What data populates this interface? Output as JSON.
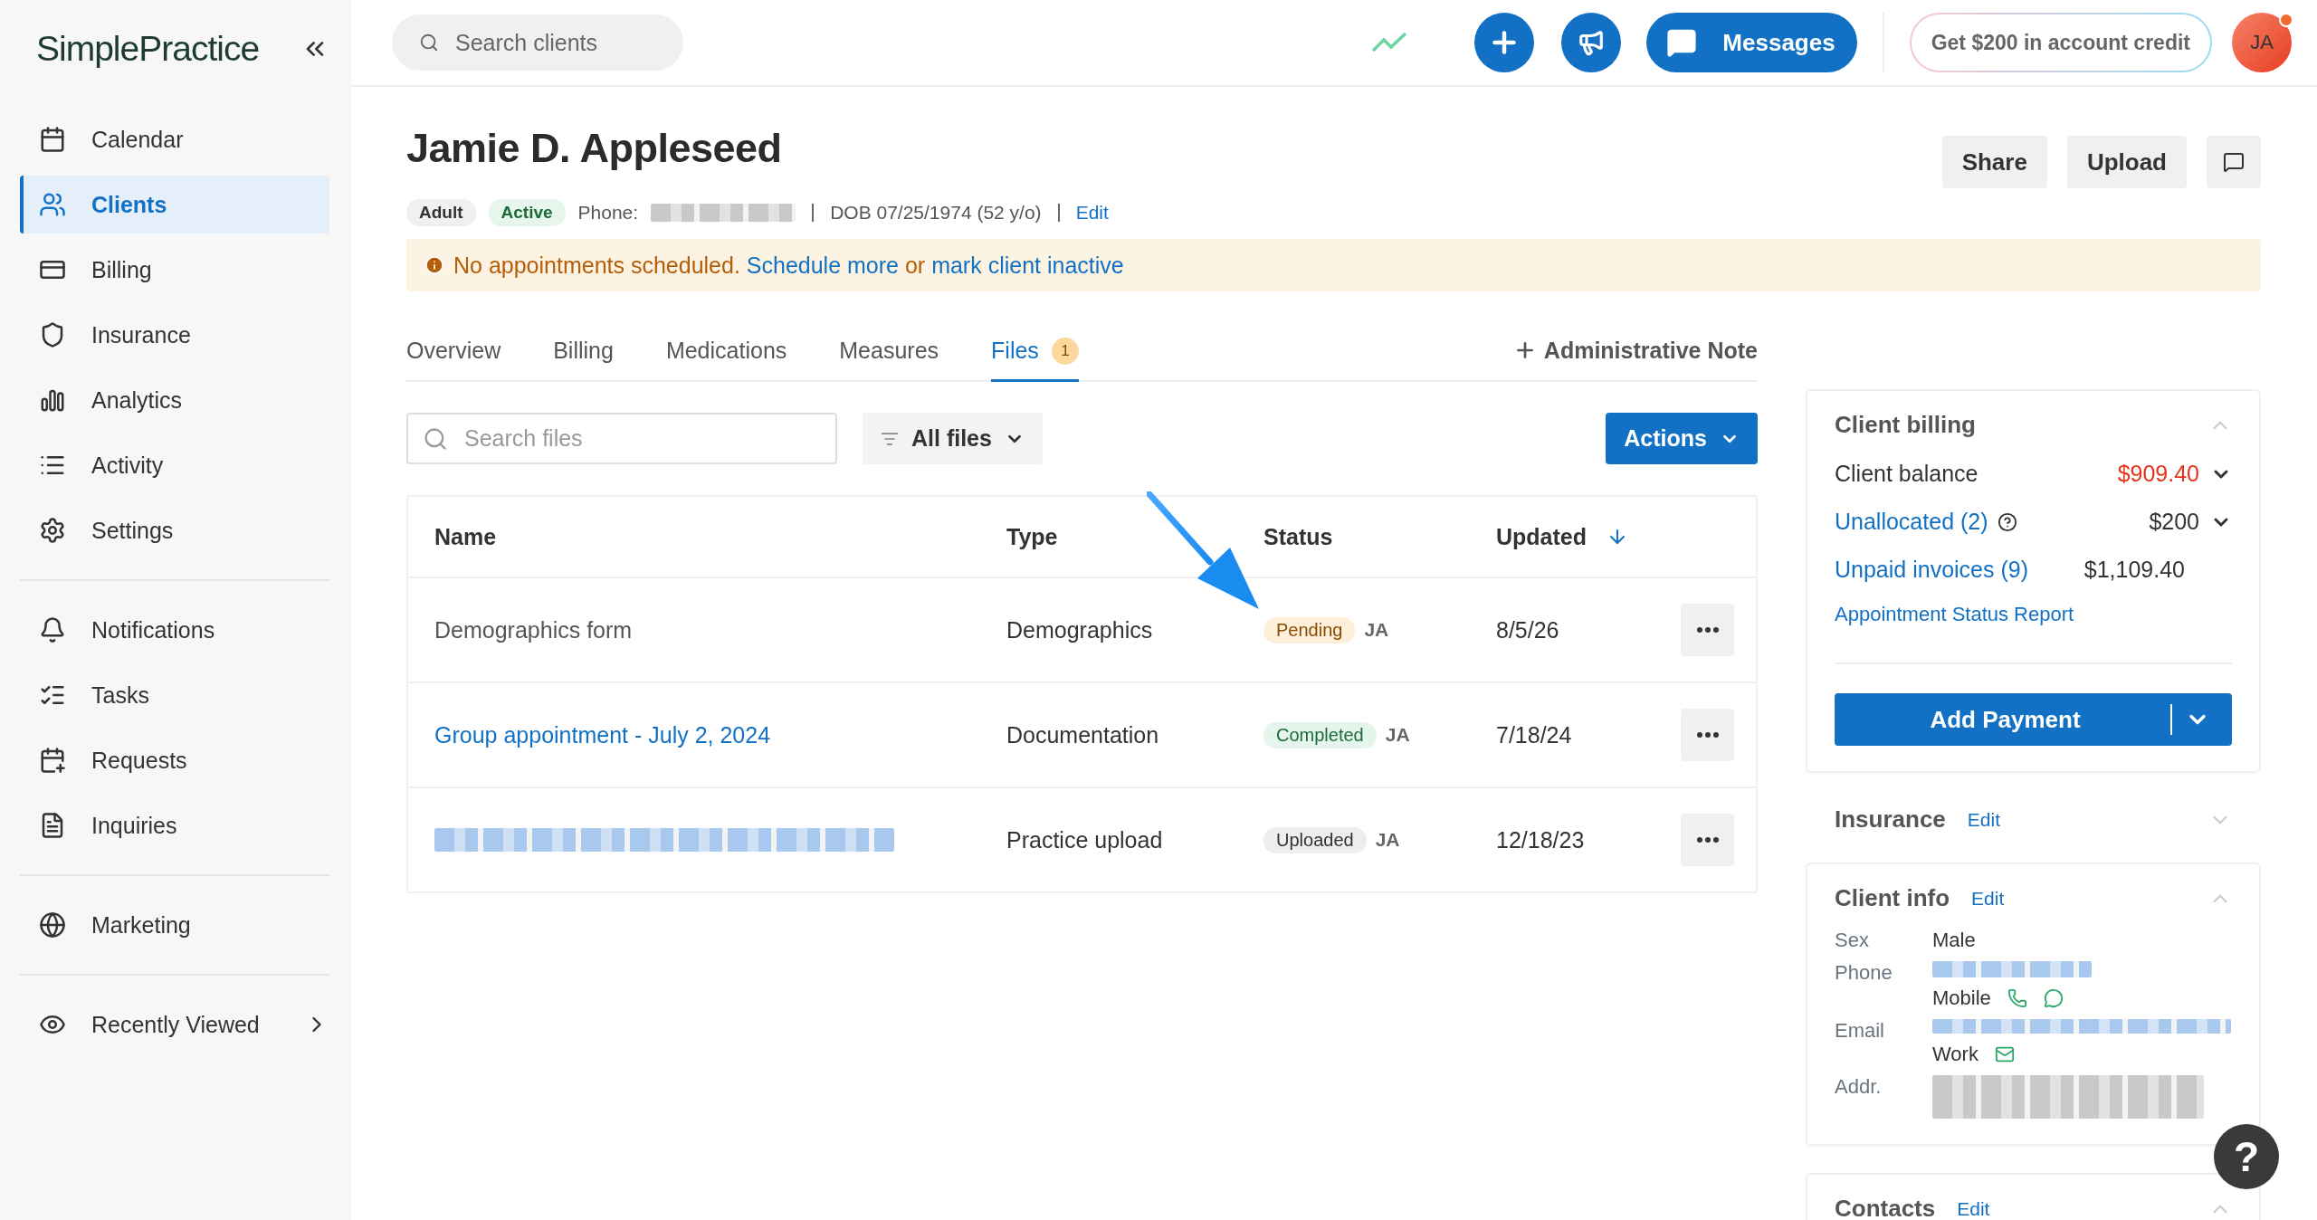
{
  "sidebar": {
    "logo": "SimplePractice",
    "sections": [
      {
        "items": [
          {
            "label": "Calendar",
            "selected": false
          },
          {
            "label": "Clients",
            "selected": true
          },
          {
            "label": "Billing",
            "selected": false
          },
          {
            "label": "Insurance",
            "selected": false
          },
          {
            "label": "Analytics",
            "selected": false
          },
          {
            "label": "Activity",
            "selected": false
          },
          {
            "label": "Settings",
            "selected": false
          }
        ]
      },
      {
        "items": [
          {
            "label": "Notifications",
            "selected": false
          },
          {
            "label": "Tasks",
            "selected": false
          },
          {
            "label": "Requests",
            "selected": false
          },
          {
            "label": "Inquiries",
            "selected": false
          }
        ]
      },
      {
        "items": [
          {
            "label": "Marketing",
            "selected": false
          }
        ]
      }
    ],
    "recently_viewed": "Recently Viewed"
  },
  "topbar": {
    "search": {
      "placeholder": "Search clients"
    },
    "messages": "Messages",
    "promo": "Get $200 in account credit",
    "avatar": {
      "initials": "JA",
      "notification": true
    }
  },
  "client": {
    "name": "Jamie D. Appleseed",
    "tags": [
      {
        "label": "Adult",
        "kind": "neutral"
      },
      {
        "label": "Active",
        "kind": "success"
      }
    ],
    "phone_label": "Phone:",
    "dob": "DOB 07/25/1974 (52 y/o)",
    "edit": "Edit",
    "buttons": [
      "Share",
      "Upload"
    ],
    "alert": {
      "message": "No appointments scheduled.",
      "link_1": "Schedule more",
      "joiner": "or",
      "link_2": "mark client inactive"
    }
  },
  "tabs": [
    {
      "label": "Overview",
      "selected": false
    },
    {
      "label": "Billing",
      "selected": false
    },
    {
      "label": "Medications",
      "selected": false
    },
    {
      "label": "Measures",
      "selected": false
    },
    {
      "label": "Files",
      "selected": true,
      "badge": "1"
    }
  ],
  "admin_note": "Administrative Note",
  "files": {
    "search": {
      "placeholder": "Search files"
    },
    "filter": "All files",
    "actions": "Actions",
    "columns": [
      "Name",
      "Type",
      "Status",
      "Updated"
    ],
    "rows": [
      {
        "name": "Demographics form",
        "kind": "plain",
        "type": "Demographics",
        "status": {
          "label": "Pending",
          "kind": "pending"
        },
        "initials": "JA",
        "updated": "8/5/26"
      },
      {
        "name": "Group appointment - July 2, 2024",
        "kind": "link",
        "type": "Documentation",
        "status": {
          "label": "Completed",
          "kind": "completed"
        },
        "initials": "JA",
        "updated": "7/18/24"
      },
      {
        "kind": "redacted",
        "type": "Practice upload",
        "status": {
          "label": "Uploaded",
          "kind": "uploaded"
        },
        "initials": "JA",
        "updated": "12/18/23"
      }
    ]
  },
  "billing": {
    "title": "Client billing",
    "expanded": true,
    "rows": [
      {
        "label": "Client balance",
        "value": "$909.40",
        "link": false,
        "alert": true,
        "dropdown": true,
        "help": false
      },
      {
        "label": "Unallocated (2)",
        "value": "$200",
        "link": true,
        "alert": false,
        "dropdown": true,
        "help": true
      },
      {
        "label": "Unpaid invoices (9)",
        "value": "$1,109.40",
        "link": true,
        "alert": false,
        "dropdown": false,
        "help": false
      }
    ],
    "report": "Appointment Status Report",
    "add_payment": "Add Payment"
  },
  "insurance": {
    "title": "Insurance",
    "edit": "Edit",
    "expanded": false
  },
  "client_info": {
    "title": "Client info",
    "edit": "Edit",
    "expanded": true,
    "fields": [
      {
        "label": "Sex",
        "value": "Male",
        "kind": "text"
      },
      {
        "label": "Phone",
        "kind": "phone",
        "sub_label": "Mobile"
      },
      {
        "label": "Email",
        "kind": "email",
        "sub_label": "Work"
      },
      {
        "label": "Addr.",
        "kind": "address"
      }
    ]
  },
  "contacts": {
    "title": "Contacts",
    "edit": "Edit",
    "expanded": true
  },
  "help_button": "?"
}
